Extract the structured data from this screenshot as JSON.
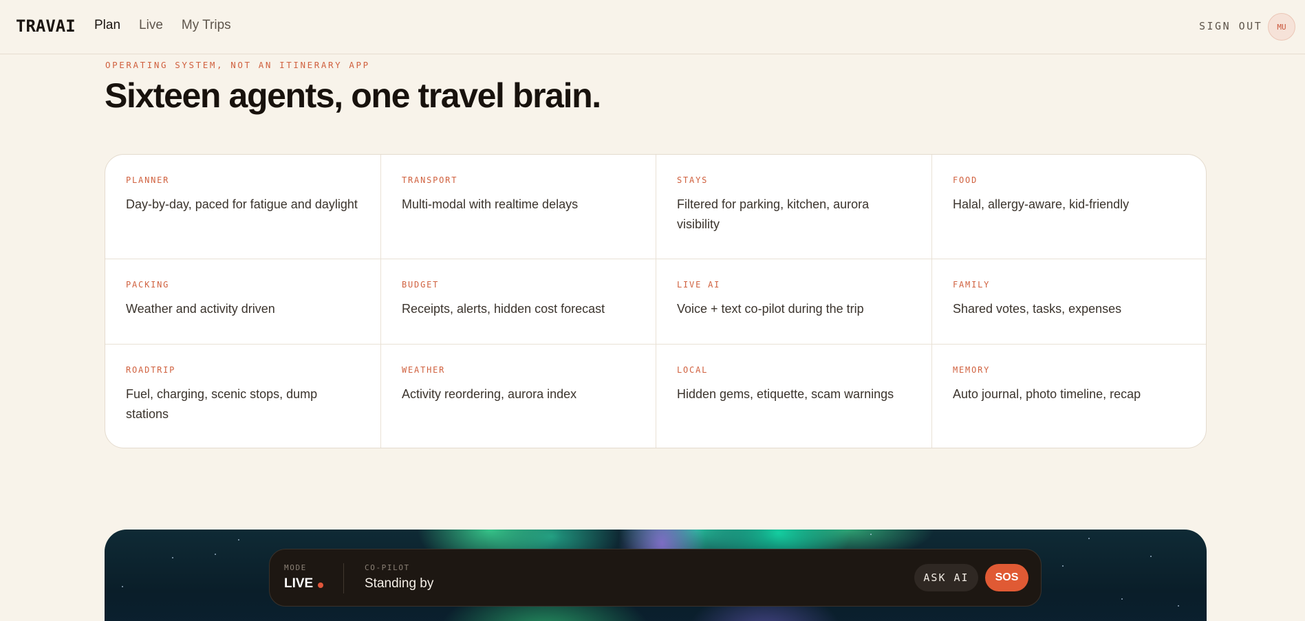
{
  "header": {
    "logo": "TRAVAI",
    "nav": [
      {
        "label": "Plan",
        "active": true
      },
      {
        "label": "Live",
        "active": false
      },
      {
        "label": "My Trips",
        "active": false
      }
    ],
    "sign_out": "SIGN OUT",
    "avatar_initials": "MU"
  },
  "hero": {
    "eyebrow": "OPERATING SYSTEM, NOT AN ITINERARY APP",
    "headline": "Sixteen agents, one travel brain."
  },
  "agents": [
    {
      "tag": "PLANNER",
      "desc": "Day-by-day, paced for fatigue and daylight"
    },
    {
      "tag": "TRANSPORT",
      "desc": "Multi-modal with realtime delays"
    },
    {
      "tag": "STAYS",
      "desc": "Filtered for parking, kitchen, aurora visibility"
    },
    {
      "tag": "FOOD",
      "desc": "Halal, allergy-aware, kid-friendly"
    },
    {
      "tag": "PACKING",
      "desc": "Weather and activity driven"
    },
    {
      "tag": "BUDGET",
      "desc": "Receipts, alerts, hidden cost forecast"
    },
    {
      "tag": "LIVE AI",
      "desc": "Voice + text co-pilot during the trip"
    },
    {
      "tag": "FAMILY",
      "desc": "Shared votes, tasks, expenses"
    },
    {
      "tag": "ROADTRIP",
      "desc": "Fuel, charging, scenic stops, dump stations"
    },
    {
      "tag": "WEATHER",
      "desc": "Activity reordering, aurora index"
    },
    {
      "tag": "LOCAL",
      "desc": "Hidden gems, etiquette, scam warnings"
    },
    {
      "tag": "MEMORY",
      "desc": "Auto journal, photo timeline, recap"
    }
  ],
  "live_bar": {
    "mode_label": "MODE",
    "mode_value": "LIVE",
    "copilot_label": "CO-PILOT",
    "copilot_value": "Standing by",
    "ask_ai": "ASK AI",
    "sos": "SOS"
  },
  "colors": {
    "background": "#f8f3ea",
    "accent": "#d0613f",
    "sos": "#e05a34",
    "live_bar": "#1d1712"
  }
}
